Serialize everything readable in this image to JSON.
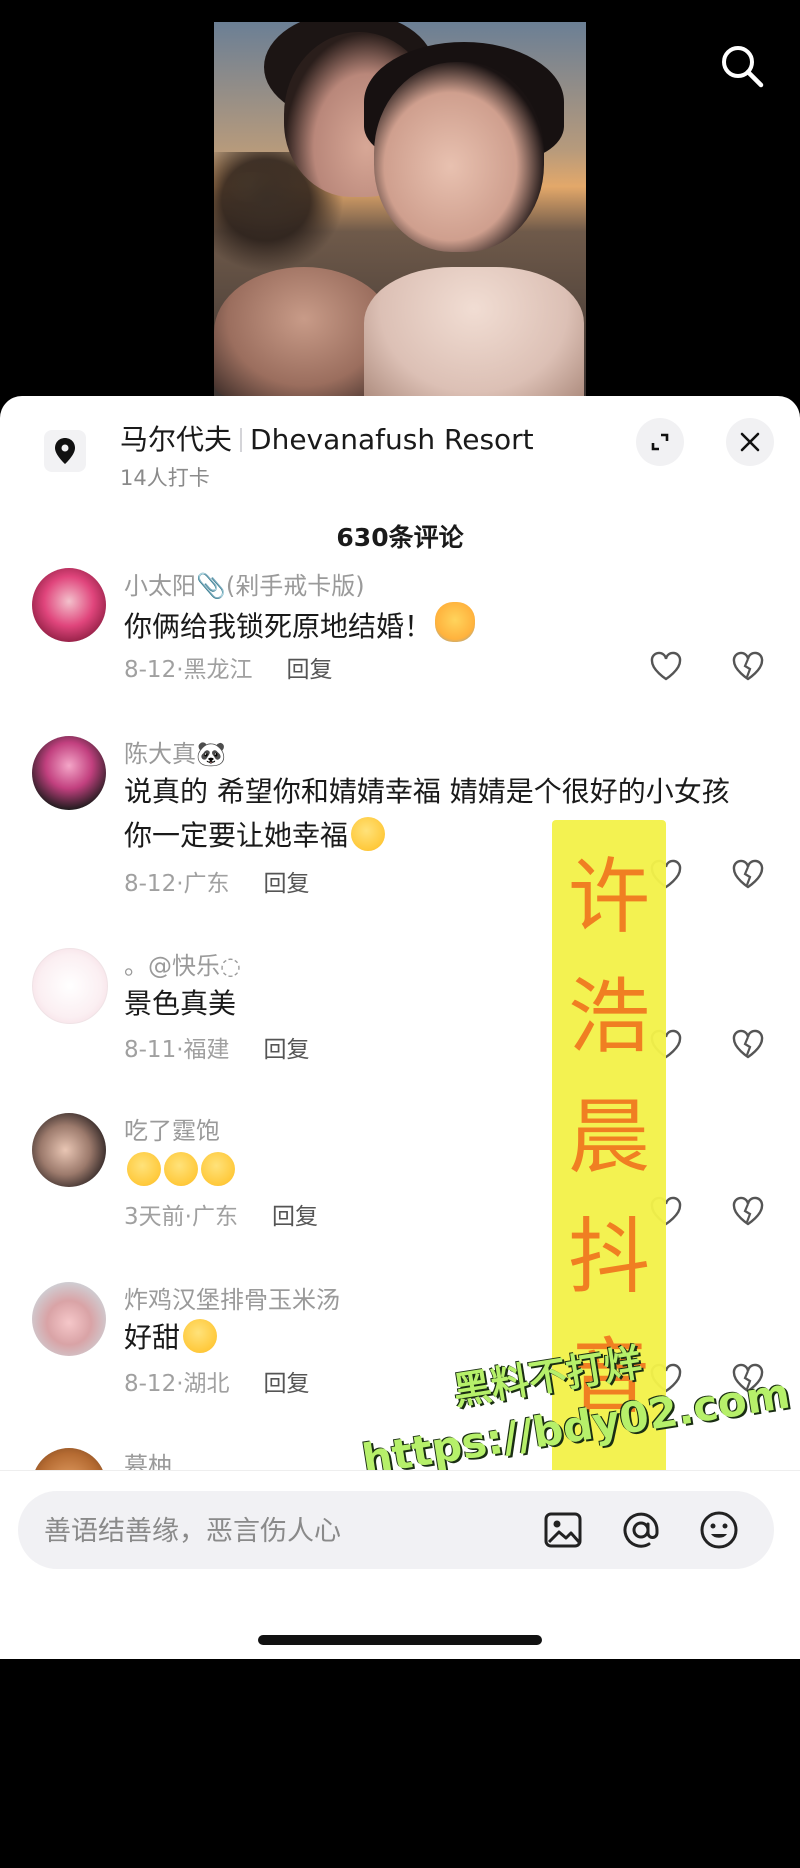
{
  "header": {
    "search_icon": "search-icon"
  },
  "location": {
    "icon": "location-pin-icon",
    "name_cn": "马尔代夫",
    "name_en": "Dhevanafush Resort",
    "checkins": "14人打卡",
    "expand_icon": "expand-icon",
    "close_icon": "close-icon"
  },
  "comments_count": "630条评论",
  "comments": [
    {
      "name": "小太阳📎(剁手戒卡版)",
      "text": "你俩给我锁死原地结婚！",
      "emoji": "hug-emoji",
      "date": "8-12",
      "region": "黑龙江",
      "reply": "回复"
    },
    {
      "name": "陈大真🐼",
      "text": "说真的 希望你和婧婧幸福 婧婧是个很好的小女孩 你一定要让她幸福",
      "emoji": "crying-emoji",
      "date": "8-12",
      "region": "广东",
      "reply": "回复"
    },
    {
      "name": "。@快乐◌",
      "text": "景色真美",
      "date": "8-11",
      "region": "福建",
      "reply": "回复"
    },
    {
      "name": "吃了霆饱",
      "text": "",
      "emoji": "laughing-crying-emoji x3",
      "date": "3天前",
      "region": "广东",
      "reply": "回复"
    },
    {
      "name": "炸鸡汉堡排骨玉米汤",
      "text": "好甜",
      "emoji": "pleading-emoji",
      "date": "8-12",
      "region": "湖北",
      "reply": "回复"
    },
    {
      "name": "慕柚"
    }
  ],
  "separator": "·",
  "watermark": {
    "vertical": [
      "许",
      "浩",
      "晨",
      "抖",
      "音"
    ],
    "line1": "黑料不打烊",
    "line2": "https://bdy02.com"
  },
  "input": {
    "placeholder": "善语结善缘，恶言伤人心"
  },
  "colors": {
    "watermark_yellow": "#f3f24a",
    "watermark_orange": "#f07a1a",
    "watermark_green": "#b6f06a"
  }
}
